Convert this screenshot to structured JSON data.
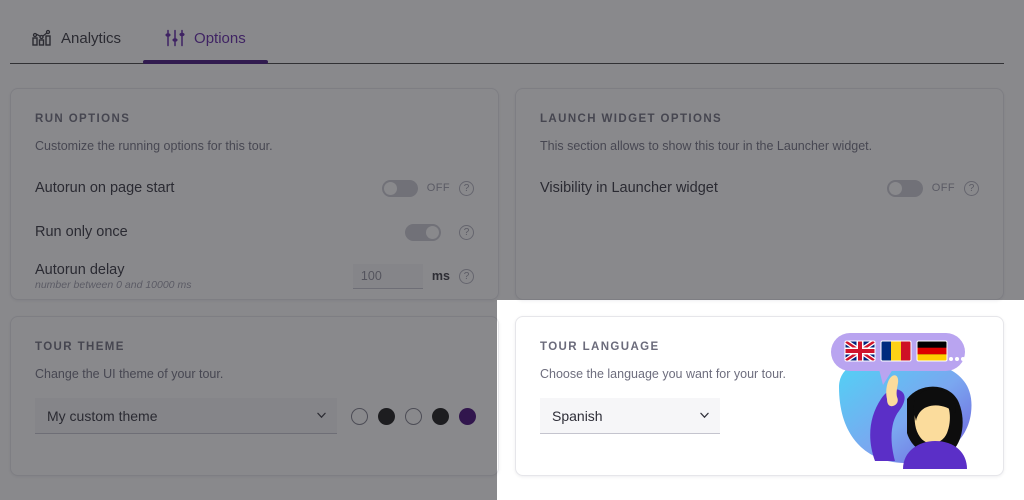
{
  "tabs": [
    {
      "label": "Analytics",
      "icon": "bar-chart-icon",
      "active": false
    },
    {
      "label": "Options",
      "icon": "sliders-icon",
      "active": true
    }
  ],
  "colors": {
    "accent": "#5b1ea5",
    "tab_indicator": "#3d0c78",
    "overlay": "rgba(40,40,46,0.55)",
    "swatch_black": "#111111",
    "swatch_purple": "#3d0173"
  },
  "run_options": {
    "title": "RUN OPTIONS",
    "subtitle": "Customize the running options for this tour.",
    "rows": [
      {
        "label": "Autorun on page start",
        "toggle": "off",
        "state_text": "OFF",
        "help": "?"
      },
      {
        "label": "Run only once",
        "toggle": "on",
        "state_text": "",
        "help": "?"
      }
    ],
    "delay": {
      "label": "Autorun delay",
      "hint": "number between 0 and 10000 ms",
      "value": "100",
      "placeholder": "100",
      "unit": "ms",
      "help": "?"
    }
  },
  "launch_widget": {
    "title": "LAUNCH WIDGET OPTIONS",
    "subtitle": "This section allows to show this tour in the Launcher widget.",
    "row": {
      "label": "Visibility in Launcher widget",
      "toggle": "off",
      "state_text": "OFF",
      "help": "?"
    }
  },
  "tour_theme": {
    "title": "TOUR THEME",
    "subtitle": "Change the UI theme of your tour.",
    "select": {
      "value": "My custom theme",
      "options": [
        "My custom theme"
      ]
    },
    "swatches": [
      {
        "name": "swatch-1",
        "fill": "none",
        "color": "#ffffff"
      },
      {
        "name": "swatch-2",
        "fill": "solid",
        "color": "#111111"
      },
      {
        "name": "swatch-3",
        "fill": "none",
        "color": "#ffffff"
      },
      {
        "name": "swatch-4",
        "fill": "solid",
        "color": "#111111"
      },
      {
        "name": "swatch-5",
        "fill": "solid",
        "color": "#3d0173"
      }
    ]
  },
  "tour_language": {
    "title": "TOUR LANGUAGE",
    "subtitle": "Choose the language you want for your tour.",
    "select": {
      "value": "Spanish",
      "options": [
        "Spanish"
      ]
    },
    "illustration": {
      "name": "language-illustration",
      "flags": [
        "united-kingdom-flag",
        "romania-flag",
        "germany-flag"
      ],
      "more": "..."
    }
  }
}
